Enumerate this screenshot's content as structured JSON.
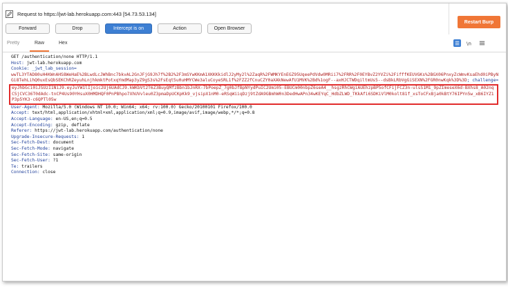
{
  "request_info": "Request to https://jwt-lab.herokuapp.com:443  [54.73.53.134]",
  "buttons": {
    "forward": "Forward",
    "drop": "Drop",
    "intercept": "Intercept is on",
    "action": "Action",
    "open_browser": "Open Browser"
  },
  "restart_label": "Restart Burp",
  "tabs": {
    "pretty": "Pretty",
    "raw": "Raw",
    "hex": "Hex"
  },
  "accent_color": "#f07636",
  "primary_color": "#3d7fd3",
  "request": {
    "request_line": "GET /authentication/none HTTP/1.1",
    "host_name": "Host:",
    "host_value": " jwt-lab.herokuapp.com",
    "cookie_name": "Cookie:",
    "cookie_key": " _jwt_lab_session=",
    "cookie_value": "wwTL3YTAD80uH4KWnAHS8WeHaE%2BLwdLcJWhBnc7bkvAL2GnJFjG9Jh7f%2B2%2F3mSYwKKmA1XKKKkidlJ2yMy2l%2ZaqR%2FWMKYEnEGZ95UqeePdVdw0MRii7%2FRR%2F0EYBvZ2YVZi%2FifffKEUVGKs%2BGX06PnxyZcWmvKsaEhd0iPByNGi8TehLihQ0uxEsQbSEKChRZeyuhLnjhkmktPotxqYmdMap3yZ9gS3s%2FsEqt5u0uHMYCWe3aluCoyeSRL1f%2FZZ2fCnuCZY0aXAkNewAfU1MVK%2Bd%1ogF--axHJCTWDqiltmUs5--dsBkLRbVgGiSEXN%2FGR0nwKqk%3D%3D",
    "cookie_trailer": "; challenge=",
    "challenge_value": "eyJhbGci0iJSUzI1NiJ9.eyJuYW1lIjoic2Uj6UAdCJ9.kWKbVt2T6Z3BuyQMfzBbn1bJnRX-7bPoepZ_7g0bJfBpNYydPuIC2Umi05-EBUCm00nbpZ6seA4__hsgzRhCWgiAUEhzpBP5ofCFijFCZ3n-ulsS1M1_9pZImeseX6d-BXhs8_A02nqC5jCVC36T0dAdc-tnCP4Us90YHsuX0HMDHQF0PnPBhpo7XhUVvleu0Z3pmaDpUCKpKk9_vjsipX1nM0-eRSqWiiqDzj9tZdA9GBmhW0n3DedHwAPn34wKEYqC_HdbZLWD_TKkAfi6SDKiVlM0kolt81f_xsToCFxBja0kBtY76IPYn5w_xB6IYZ1P3p5YK3-c6QPTl05w",
    "headers": [
      {
        "name": "User-Agent:",
        "value": " Mozilla/5.0 (Windows NT 10.0; Win64; x64; rv:100.0) Gecko/20100101 Firefox/100.0"
      },
      {
        "name": "Accept:",
        "value": " text/html,application/xhtml+xml,application/xml;q=0.9,image/avif,image/webp,*/*;q=0.8"
      },
      {
        "name": "Accept-Language:",
        "value": " en-US,en;q=0.5"
      },
      {
        "name": "Accept-Encoding:",
        "value": " gzip, deflate"
      },
      {
        "name": "Referer:",
        "value": " https://jwt-lab.herokuapp.com/authentication/none"
      },
      {
        "name": "Upgrade-Insecure-Requests:",
        "value": " 1"
      },
      {
        "name": "Sec-Fetch-Dest:",
        "value": " document"
      },
      {
        "name": "Sec-Fetch-Mode:",
        "value": " navigate"
      },
      {
        "name": "Sec-Fetch-Site:",
        "value": " same-origin"
      },
      {
        "name": "Sec-Fetch-User:",
        "value": " ?1"
      },
      {
        "name": "Te:",
        "value": " trailers"
      },
      {
        "name": "Connection:",
        "value": " close"
      }
    ]
  }
}
